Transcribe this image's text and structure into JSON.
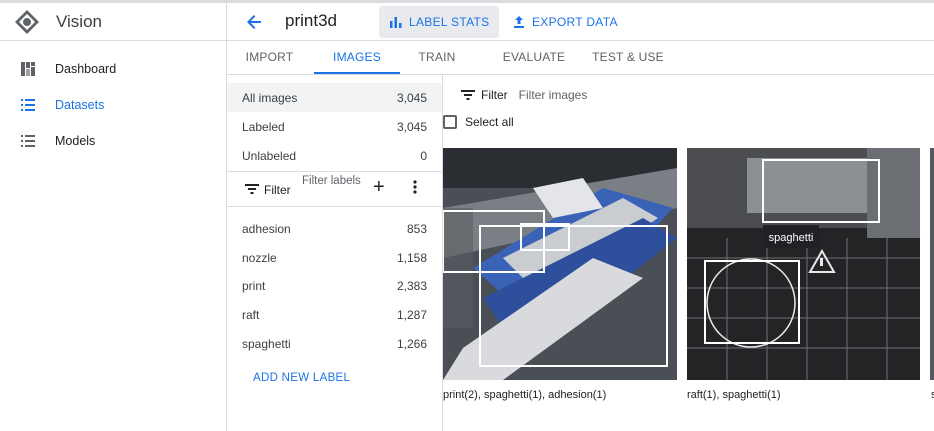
{
  "app": {
    "name": "Vision"
  },
  "nav": {
    "items": [
      {
        "label": "Dashboard",
        "icon": "dashboard-icon"
      },
      {
        "label": "Datasets",
        "icon": "list-icon",
        "active": true
      },
      {
        "label": "Models",
        "icon": "list-icon"
      }
    ]
  },
  "header": {
    "title": "print3d",
    "label_stats": "LABEL STATS",
    "export_data": "EXPORT DATA"
  },
  "tabs": [
    {
      "label": "IMPORT"
    },
    {
      "label": "IMAGES",
      "active": true
    },
    {
      "label": "TRAIN"
    },
    {
      "label": "EVALUATE"
    },
    {
      "label": "TEST & USE"
    }
  ],
  "counts": [
    {
      "label": "All images",
      "value": "3,045"
    },
    {
      "label": "Labeled",
      "value": "3,045"
    },
    {
      "label": "Unlabeled",
      "value": "0"
    }
  ],
  "label_filter": {
    "label": "Filter",
    "placeholder": "Filter labels"
  },
  "labels": [
    {
      "name": "adhesion",
      "count": "853"
    },
    {
      "name": "nozzle",
      "count": "1,158"
    },
    {
      "name": "print",
      "count": "2,383"
    },
    {
      "name": "raft",
      "count": "1,287"
    },
    {
      "name": "spaghetti",
      "count": "1,266"
    }
  ],
  "add_label": "ADD NEW LABEL",
  "image_filter": {
    "label": "Filter",
    "placeholder": "Filter images"
  },
  "select_all": "Select all",
  "images": [
    {
      "caption": "print(2), spaghetti(1), adhesion(1)"
    },
    {
      "caption": "raft(1), spaghetti(1)",
      "tooltip": "spaghetti"
    },
    {
      "caption": "s"
    }
  ],
  "colors": {
    "accent": "#1a73e8",
    "divider": "#dadce0"
  }
}
